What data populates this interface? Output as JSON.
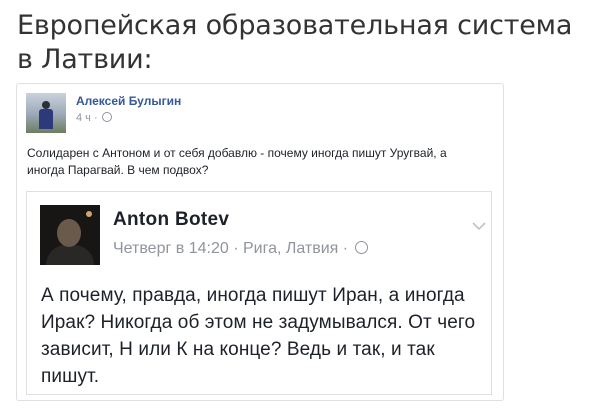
{
  "page": {
    "title": "Европейская образовательная система в Латвии:"
  },
  "outer_post": {
    "author": "Алексей Булыгин",
    "time": "4 ч",
    "separator": "·",
    "text": "Солидарен с Антоном и от себя добавлю - почему иногда пишут Уругвай, а иногда Парагвай. В чем подвох?"
  },
  "shared_post": {
    "author": "Anton Botev",
    "date": "Четверг в 14:20",
    "separator": "·",
    "location": "Рига, Латвия",
    "text": "А почему, правда, иногда пишут Иран, а иногда Ирак? Никогда об этом не задумывался. От чего зависит, Н или К на конце? Ведь и так, и так пишут."
  },
  "icons": {
    "privacy": "globe-icon",
    "menu": "chevron-down-icon"
  },
  "colors": {
    "author_link": "#365899",
    "meta_text": "#90949c",
    "border": "#dddfe2"
  }
}
